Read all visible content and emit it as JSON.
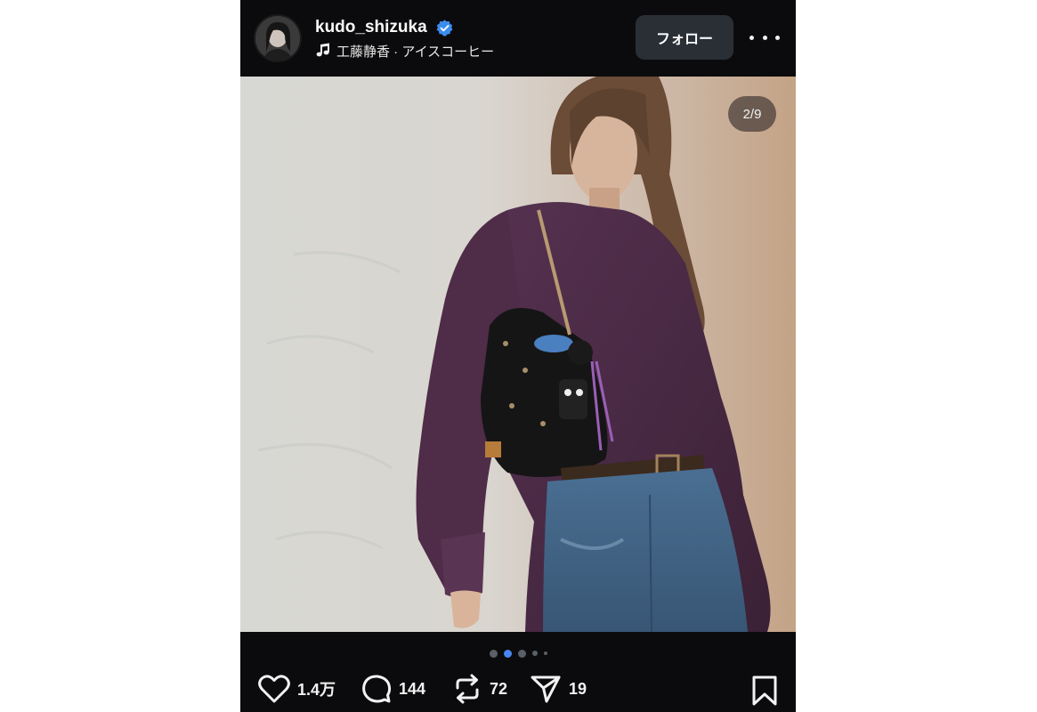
{
  "header": {
    "username": "kudo_shizuka",
    "music": "工藤静香 · アイスコーヒー",
    "follow_label": "フォロー"
  },
  "photo": {
    "counter": "2/9"
  },
  "carousel": {
    "dot_count": 5,
    "active_index": 1
  },
  "actions": {
    "likes": "1.4万",
    "comments": "144",
    "reposts": "72",
    "shares": "19"
  },
  "colors": {
    "background": "#0b0b0d",
    "verified": "#3b8cf0",
    "active_dot": "#4a86f0",
    "blouse": "#4a2a44",
    "jeans": "#3f6486"
  }
}
